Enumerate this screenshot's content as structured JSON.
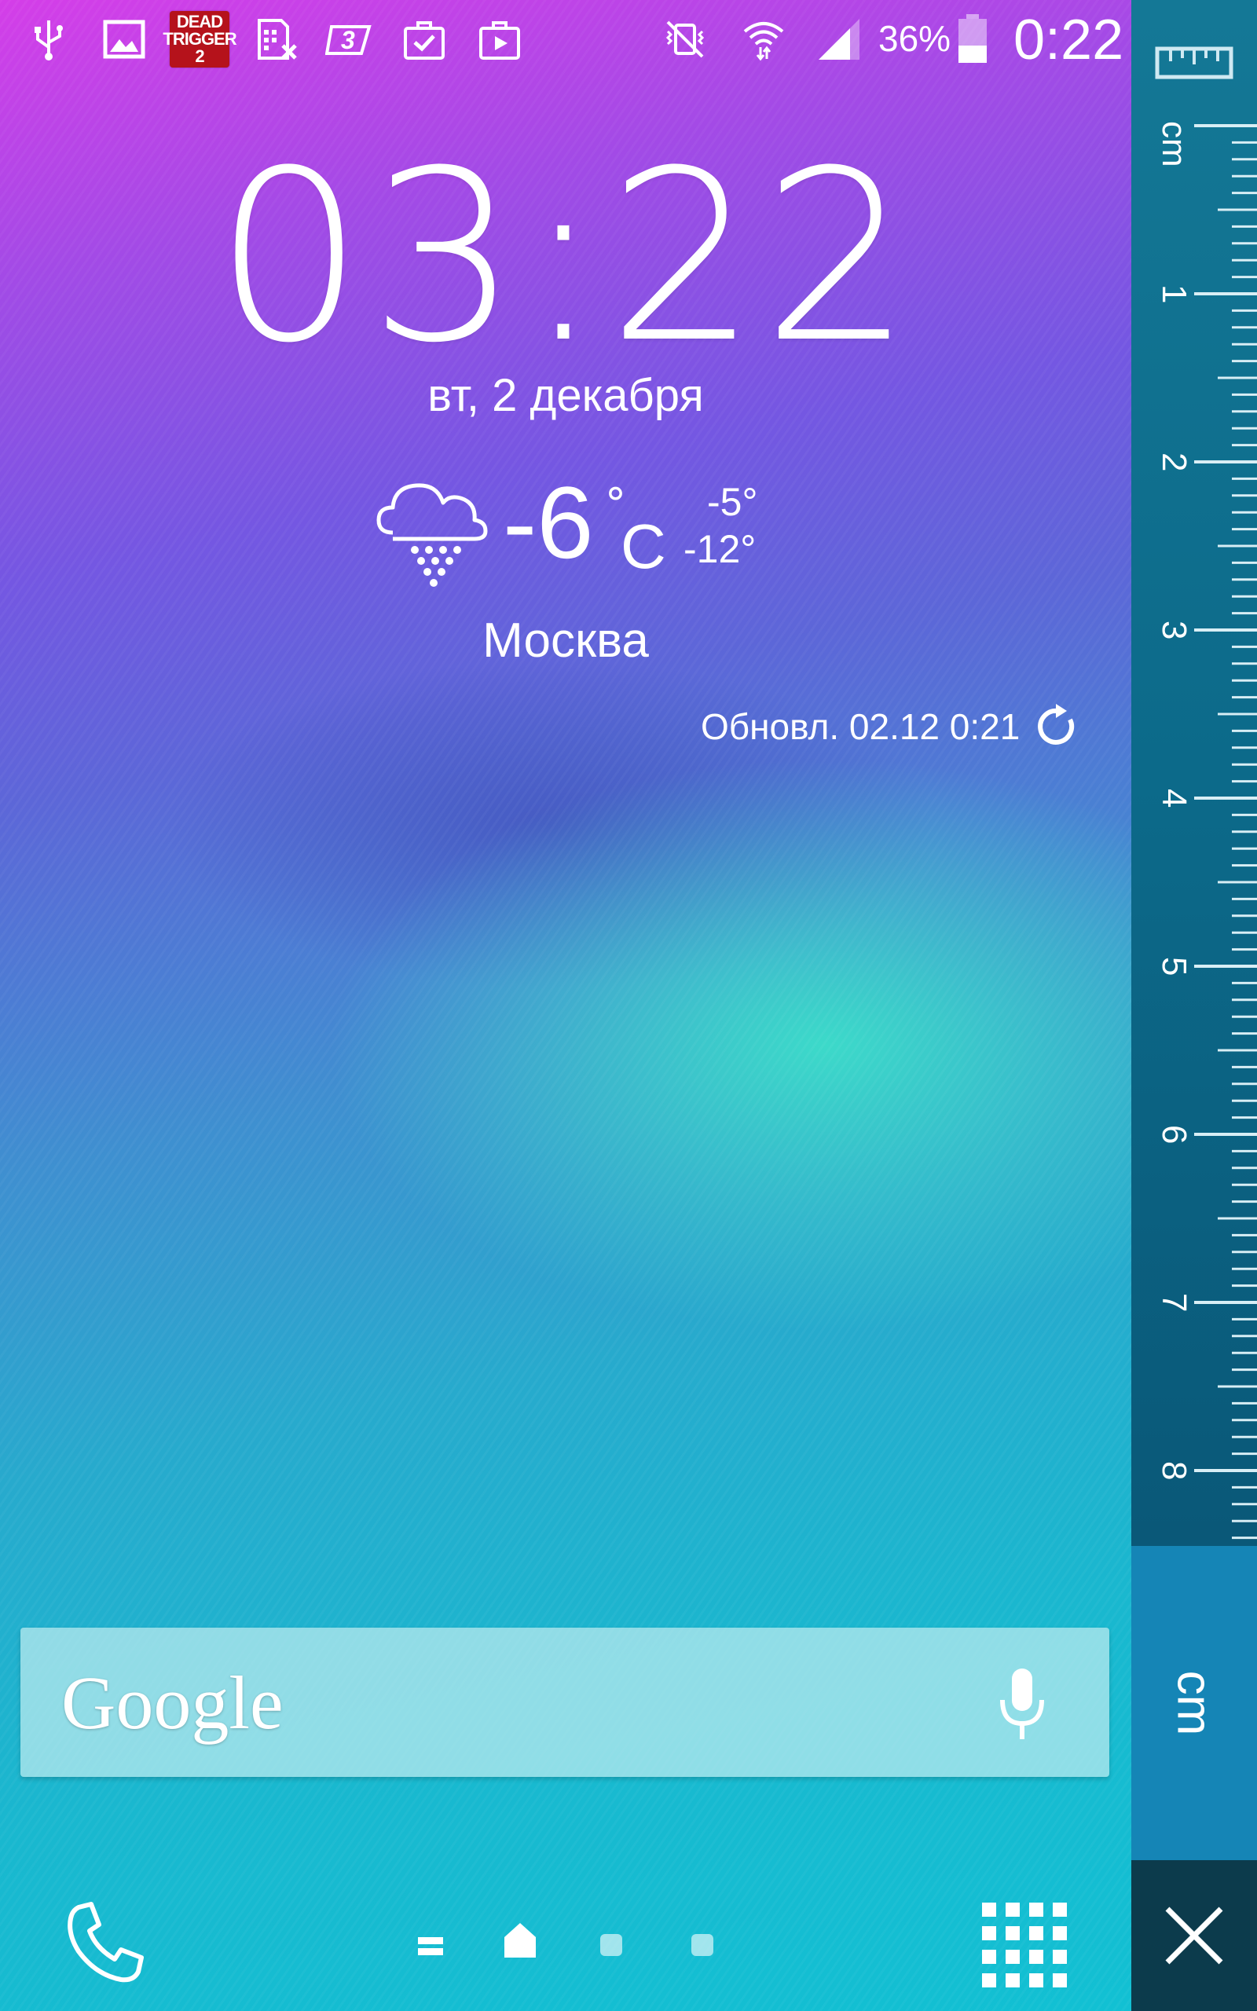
{
  "status_bar": {
    "notifications": [
      "usb-icon",
      "gallery-icon",
      "dead-trigger-2-icon",
      "sim-card-icon",
      "app-3-icon",
      "briefcase-check-icon",
      "briefcase-play-icon"
    ],
    "dead_trigger_label": "DEAD TRIGGER 2",
    "battery_percent": "36%",
    "time": "0:22"
  },
  "clock": {
    "time": "03:22",
    "date": "вт, 2 декабря"
  },
  "weather": {
    "icon": "snow-cloud-icon",
    "temperature": "-6",
    "degree_symbol": "°",
    "unit": "C",
    "high": "-5°",
    "low": "-12°",
    "city": "Москва",
    "updated": "Обновл. 02.12 0:21"
  },
  "search": {
    "logo_text": "Google",
    "mic_icon": "microphone-icon"
  },
  "dock": {
    "phone_icon": "phone-icon",
    "apps_icon": "apps-grid-icon",
    "pages": [
      "pages-overview",
      "home",
      "page-2",
      "page-3"
    ],
    "current_page": "home"
  },
  "ruler": {
    "unit_label": "cm",
    "top_label": "cm",
    "numbers": [
      "1",
      "2",
      "3",
      "4",
      "5",
      "6",
      "7",
      "8"
    ],
    "close_icon": "close-icon",
    "ruler_icon": "ruler-icon"
  },
  "colors": {
    "ruler_bg": "#0c6a8a",
    "unit_tab": "#1585b6",
    "close_bg": "#0c3b4c"
  }
}
